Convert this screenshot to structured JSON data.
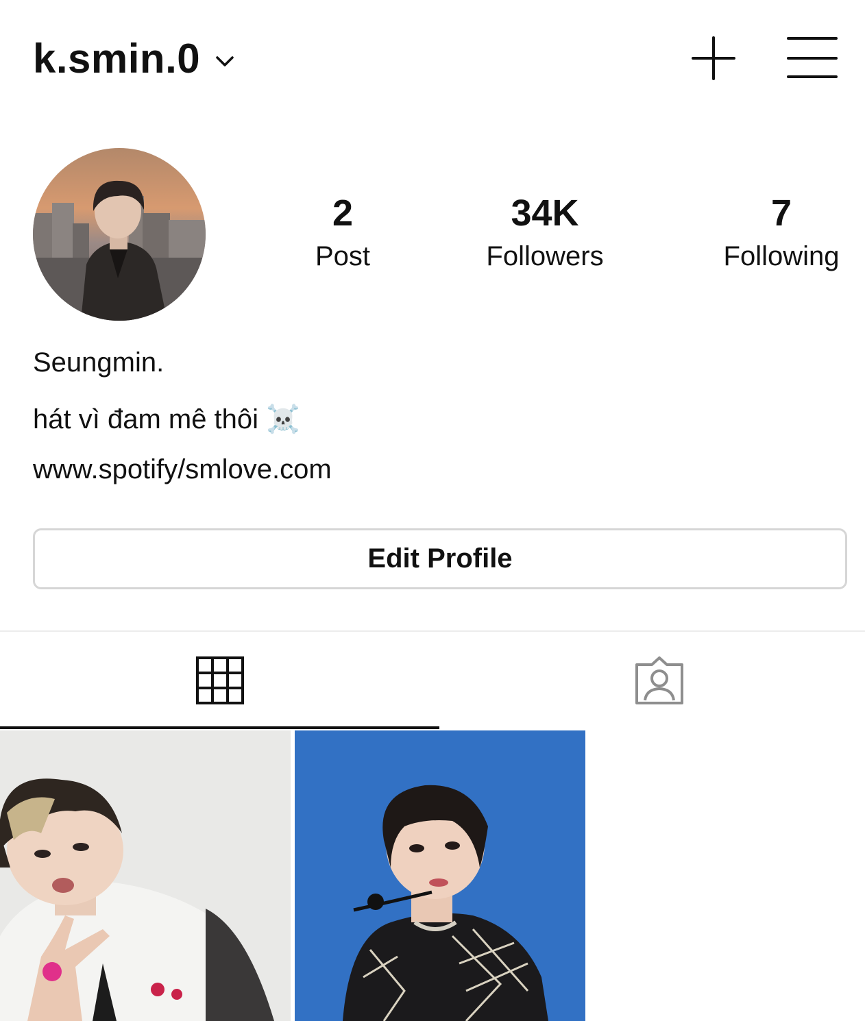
{
  "header": {
    "username": "k.smin.0",
    "dropdown_icon": "chevron-down-icon",
    "create_icon": "plus-icon",
    "menu_icon": "hamburger-menu-icon"
  },
  "profile": {
    "stats": {
      "posts_count": "2",
      "posts_label": "Post",
      "followers_count": "34K",
      "followers_label": "Followers",
      "following_count": "7",
      "following_label": "Following"
    },
    "bio": {
      "name": "Seungmin.",
      "text": "hát vì đam mê thôi ☠️",
      "link": "www.spotify/smlove.com"
    },
    "edit_button": "Edit Profile"
  },
  "tabs": [
    {
      "name": "posts-grid",
      "icon": "grid-icon",
      "active": true
    },
    {
      "name": "tagged",
      "icon": "tagged-person-icon",
      "active": false
    }
  ],
  "posts_count_shown": 2,
  "colors": {
    "text": "#111111",
    "border": "#d6d6d6",
    "divider": "#ececec",
    "inactive_icon": "#8e8e8e",
    "post2_background": "#2f6cc0"
  }
}
